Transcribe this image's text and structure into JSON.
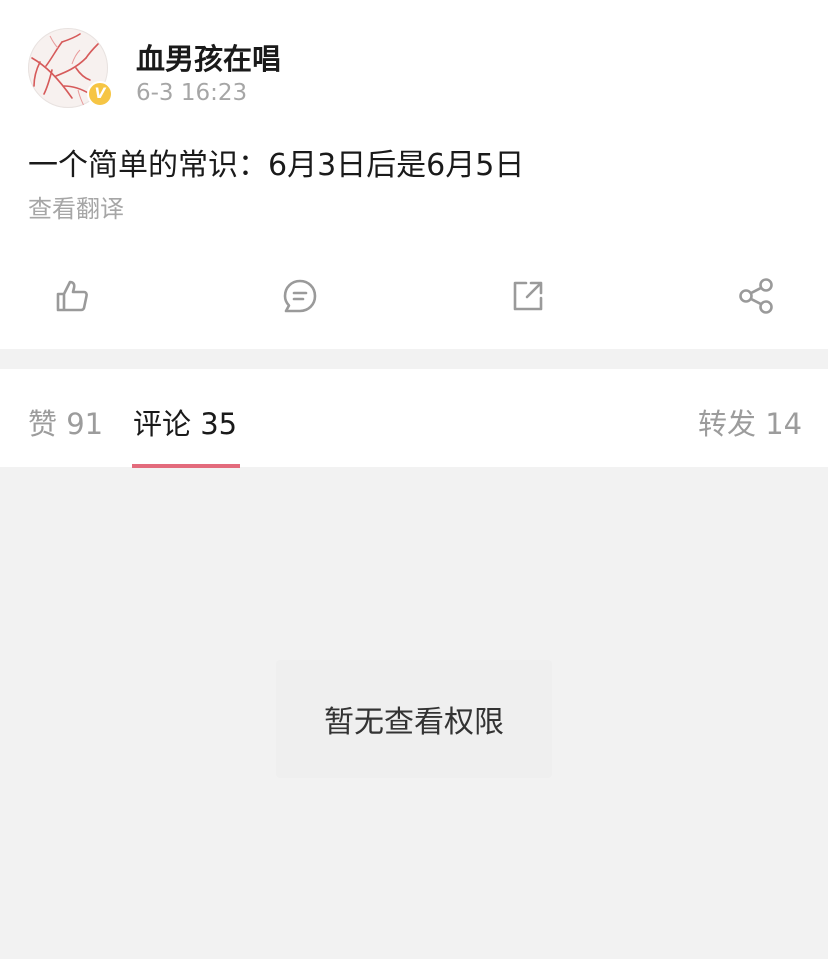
{
  "post": {
    "author": "血男孩在唱",
    "time": "6-3 16:23",
    "verified_badge": "V",
    "text": "一个简单的常识：6月3日后是6月5日",
    "translate_link": "查看翻译",
    "actions": [
      {
        "name": "like",
        "icon": "thumbs-up-icon"
      },
      {
        "name": "comment",
        "icon": "comment-bubble-icon"
      },
      {
        "name": "repost",
        "icon": "external-link-icon"
      },
      {
        "name": "share",
        "icon": "share-nodes-icon"
      }
    ]
  },
  "tabs": {
    "likes": "赞 91",
    "comments": "评论 35",
    "reposts": "转发 14",
    "active": "comments",
    "underline_color": "#e36b7c"
  },
  "comments_area": {
    "message": "暂无查看权限"
  },
  "colors": {
    "verified": "#f6c544",
    "background": "#f2f2f2",
    "icon_gray": "#9a9a9a"
  }
}
